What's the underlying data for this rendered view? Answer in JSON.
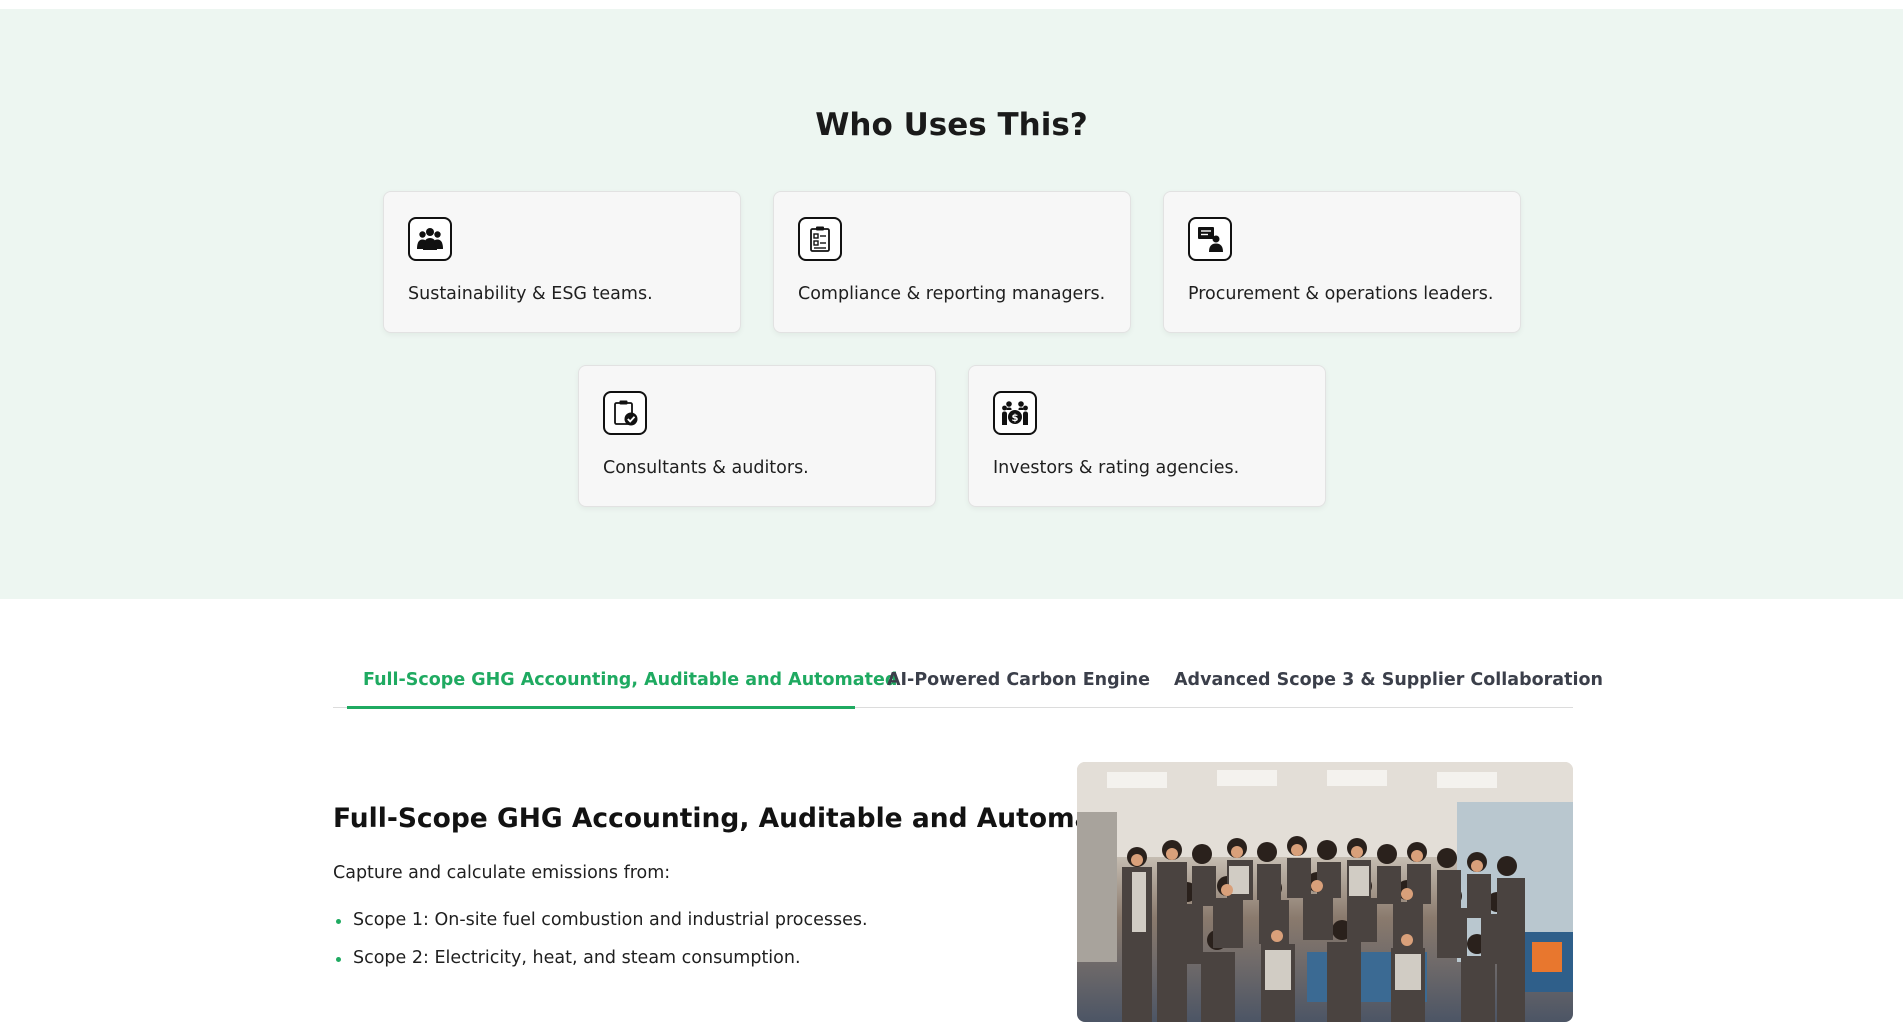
{
  "who_section": {
    "title": "Who Uses This?",
    "cards": [
      {
        "label": "Sustainability & ESG teams.",
        "icon": "team-icon"
      },
      {
        "label": "Compliance & reporting managers.",
        "icon": "clipboard-report-icon"
      },
      {
        "label": "Procurement & operations leaders.",
        "icon": "presenter-icon"
      },
      {
        "label": "Consultants & auditors.",
        "icon": "clipboard-check-icon"
      },
      {
        "label": "Investors & rating agencies.",
        "icon": "investor-group-icon"
      }
    ]
  },
  "tabs": [
    {
      "label": "Full-Scope GHG Accounting, Auditable and Automated",
      "active": true
    },
    {
      "label": "AI-Powered Carbon Engine",
      "active": false
    },
    {
      "label": "Advanced Scope 3 & Supplier Collaboration",
      "active": false
    }
  ],
  "content": {
    "title": "Full-Scope GHG Accounting, Auditable and Automated",
    "intro": "Capture and calculate emissions from:",
    "bullets": [
      "Scope 1: On-site fuel combustion and industrial processes.",
      "Scope 2: Electricity, heat, and steam consumption."
    ]
  },
  "colors": {
    "accent": "#1faa61",
    "section_bg": "#edf6f1",
    "card_bg": "#f7f7f7"
  }
}
